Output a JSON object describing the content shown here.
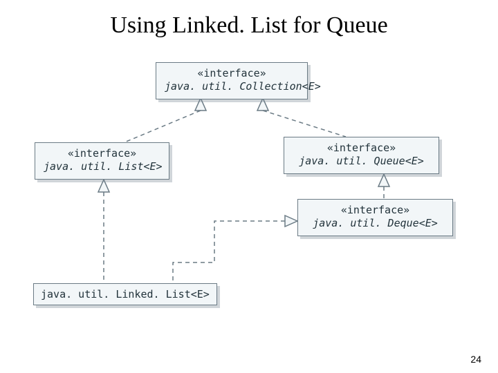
{
  "title": "Using Linked. List for Queue",
  "page_number": "24",
  "uml": {
    "stereotype": "«interface»",
    "collection": "java. util. Collection<E>",
    "list": "java. util. List<E>",
    "queue": "java. util. Queue<E>",
    "deque": "java. util. Deque<E>",
    "linkedlist": "java. util. Linked. List<E>"
  }
}
